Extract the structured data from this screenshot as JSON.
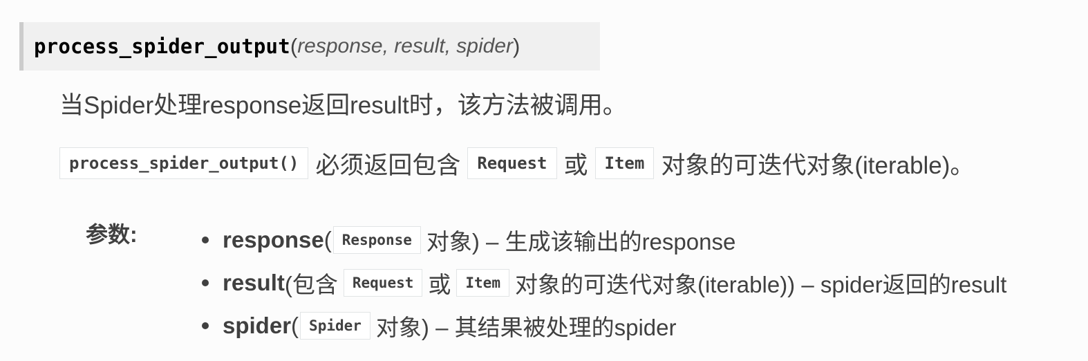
{
  "signature": {
    "name": "process_spider_output",
    "open_paren": "(",
    "params": "response, result, spider",
    "close_paren": ")"
  },
  "description": {
    "line1": "当Spider处理response返回result时，该方法被调用。",
    "line2": {
      "code1": "process_spider_output()",
      "text1": "必须返回包含",
      "code2": "Request",
      "text2": "或",
      "code3": "Item",
      "text3": "对象的可迭代对象(iterable)。"
    }
  },
  "parameters": {
    "label": "参数:",
    "items": [
      {
        "name": "response",
        "open": " (",
        "code": "Response",
        "rest": "对象) – 生成该输出的response"
      },
      {
        "name": "result",
        "open": " (包含",
        "code": "Request",
        "mid": "或",
        "code2": "Item",
        "rest": "对象的可迭代对象(iterable)) – spider返回的result"
      },
      {
        "name": "spider",
        "open": " (",
        "code": "Spider",
        "rest": "对象) – 其结果被处理的spider"
      }
    ]
  }
}
